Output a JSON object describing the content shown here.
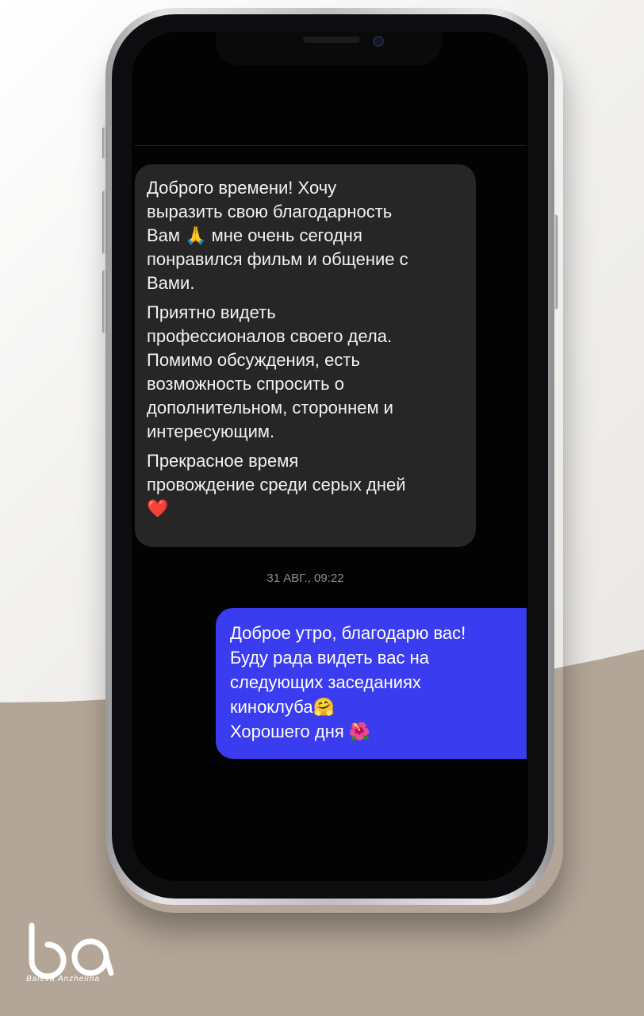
{
  "conversation": {
    "incoming_message": {
      "paragraphs": [
        "Доброго времени! Хочу\nвыразить свою благодарность\nВам 🙏 мне очень сегодня\nпонравился фильм и общение с\nВами.",
        "Приятно видеть\nпрофессионалов своего дела.\nПомимо обсуждения, есть\nвозможность спросить о\nдополнительном, стороннем и\nинтересующим.",
        "Прекрасное время\nпровождение среди серых дней\n❤️"
      ]
    },
    "timestamp": "31 АВГ., 09:22",
    "outgoing_message": {
      "text": "Доброе утро, благодарю вас!\nБуду рада видеть вас на\nследующих заседаниях\nкиноклуба🤗\nХорошего дня 🌺"
    }
  },
  "colors": {
    "incoming_bubble": "#262626",
    "outgoing_bubble": "#3a3cf0",
    "screen_background": "#030303",
    "timestamp": "#8f8f93"
  },
  "branding": {
    "logo_icon": "ba-monogram-logo",
    "logo_text": "Baleva Anzhelina"
  }
}
